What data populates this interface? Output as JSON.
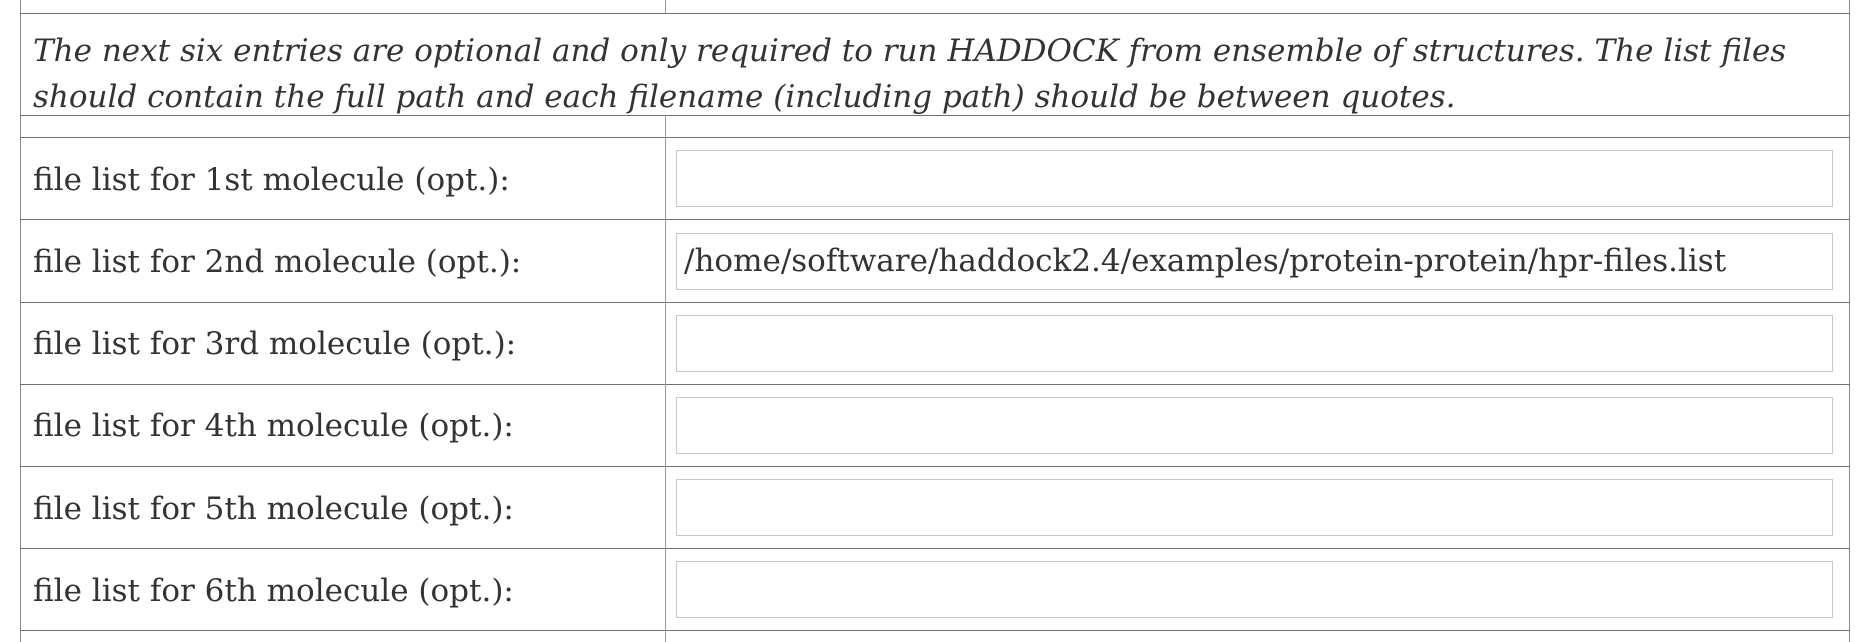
{
  "intro_note": "The next six entries are optional and only required to run HADDOCK from ensemble of structures. The list files should contain the full path and each filename (including path) should be between quotes.",
  "rows": [
    {
      "label": "file list for 1st molecule (opt.):",
      "value": ""
    },
    {
      "label": "file list for 2nd molecule (opt.):",
      "value": "/home/software/haddock2.4/examples/protein-protein/hpr-files.list"
    },
    {
      "label": "file list for 3rd molecule (opt.):",
      "value": ""
    },
    {
      "label": "file list for 4th molecule (opt.):",
      "value": ""
    },
    {
      "label": "file list for 5th molecule (opt.):",
      "value": ""
    },
    {
      "label": "file list for 6th molecule (opt.):",
      "value": ""
    }
  ]
}
